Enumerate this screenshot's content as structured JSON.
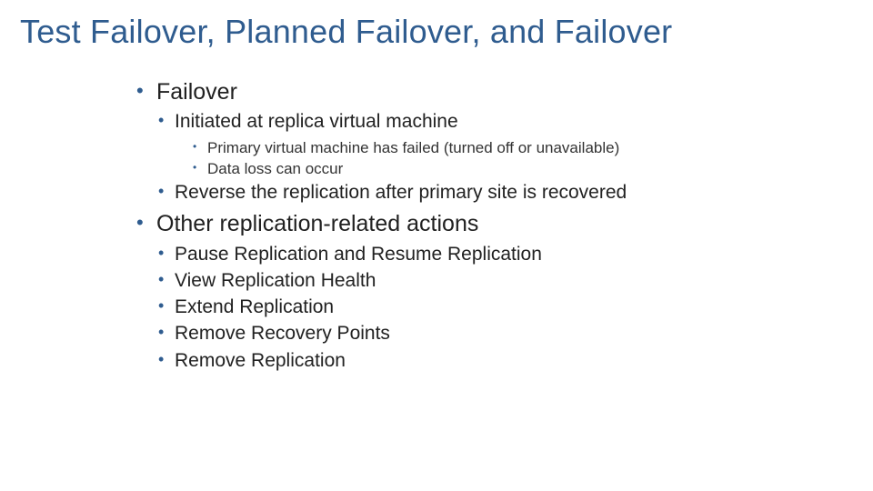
{
  "colors": {
    "title": "#2F5C8F",
    "bullet_l1": "#2F5C8F",
    "bullet_l2": "#2F5C8F",
    "bullet_l3": "#2F5C8F",
    "text": "#212121"
  },
  "slide": {
    "title": "Test Failover, Planned Failover, and Failover",
    "items": [
      {
        "label": "Failover",
        "children": [
          {
            "label": "Initiated at replica virtual machine",
            "children": [
              {
                "label": "Primary virtual machine has failed (turned off or unavailable)"
              },
              {
                "label": "Data loss can occur"
              }
            ]
          },
          {
            "label": "Reverse the replication after primary site is recovered"
          }
        ]
      },
      {
        "label": "Other replication-related actions",
        "children": [
          {
            "label": "Pause Replication and Resume Replication"
          },
          {
            "label": "View Replication Health"
          },
          {
            "label": "Extend Replication"
          },
          {
            "label": "Remove Recovery Points"
          },
          {
            "label": "Remove Replication"
          }
        ]
      }
    ]
  }
}
